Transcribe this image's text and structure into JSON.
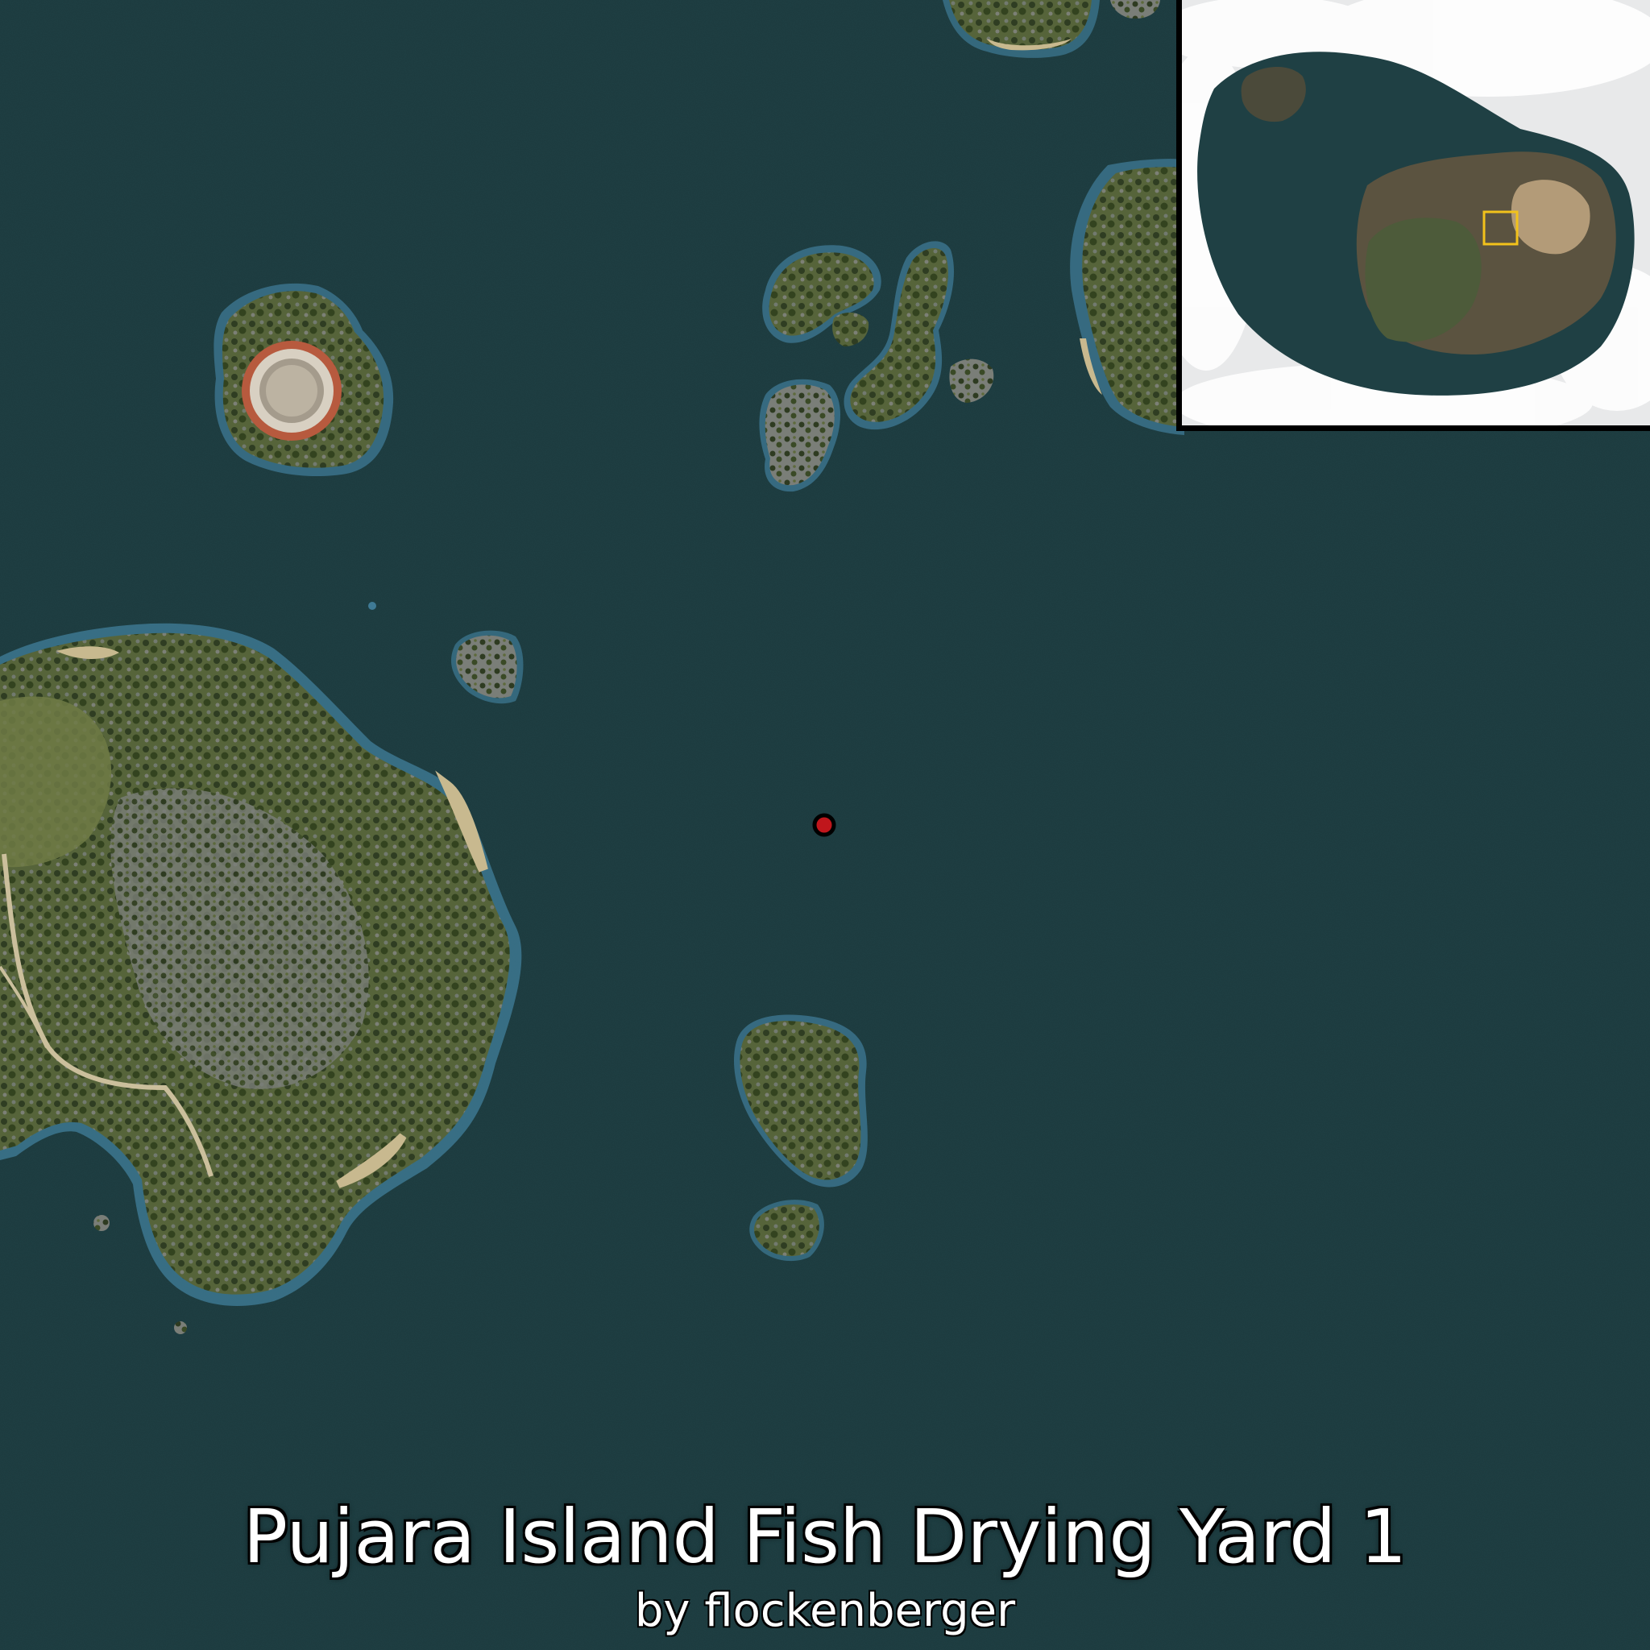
{
  "map": {
    "title": "Pujara Island Fish Drying Yard 1",
    "author": "by flockenberger",
    "marker_icon": "location-dot-icon",
    "colors": {
      "sea": "#1f4044",
      "shallows": "#3f7a95",
      "land_green": "#5e6b3c",
      "rock": "#6f7570",
      "sand": "#c8b98f",
      "marker": "#c0161c",
      "minimap_highlight": "#f2c21b"
    }
  }
}
